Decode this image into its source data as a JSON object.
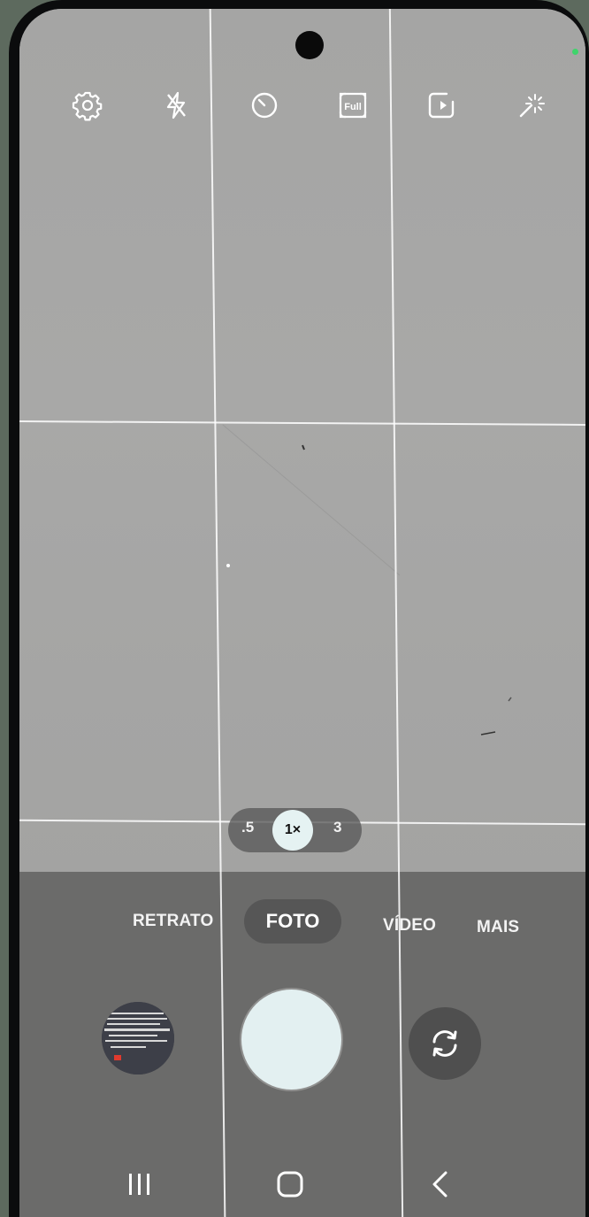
{
  "top_bar": {
    "icons": [
      "gear-icon",
      "flash-off-icon",
      "timer-icon",
      "aspect-ratio-icon",
      "motion-photo-icon",
      "filters-icon"
    ],
    "aspect_ratio_label": "Full"
  },
  "zoom": {
    "options": [
      ".5",
      "1×",
      "3"
    ],
    "selected": "1×"
  },
  "modes": {
    "items": [
      "RETRATO",
      "FOTO",
      "VÍDEO",
      "MAIS"
    ],
    "selected": "FOTO"
  },
  "controls": {
    "gallery": "gallery-thumbnail",
    "shutter": "shutter-button",
    "switch": "switch-camera-icon"
  },
  "nav": [
    "recent-apps-icon",
    "home-icon",
    "back-icon"
  ],
  "colors": {
    "accent": "#e5f2f2",
    "status_dot": "#3fd46b",
    "panel": "#6b6b6a"
  }
}
